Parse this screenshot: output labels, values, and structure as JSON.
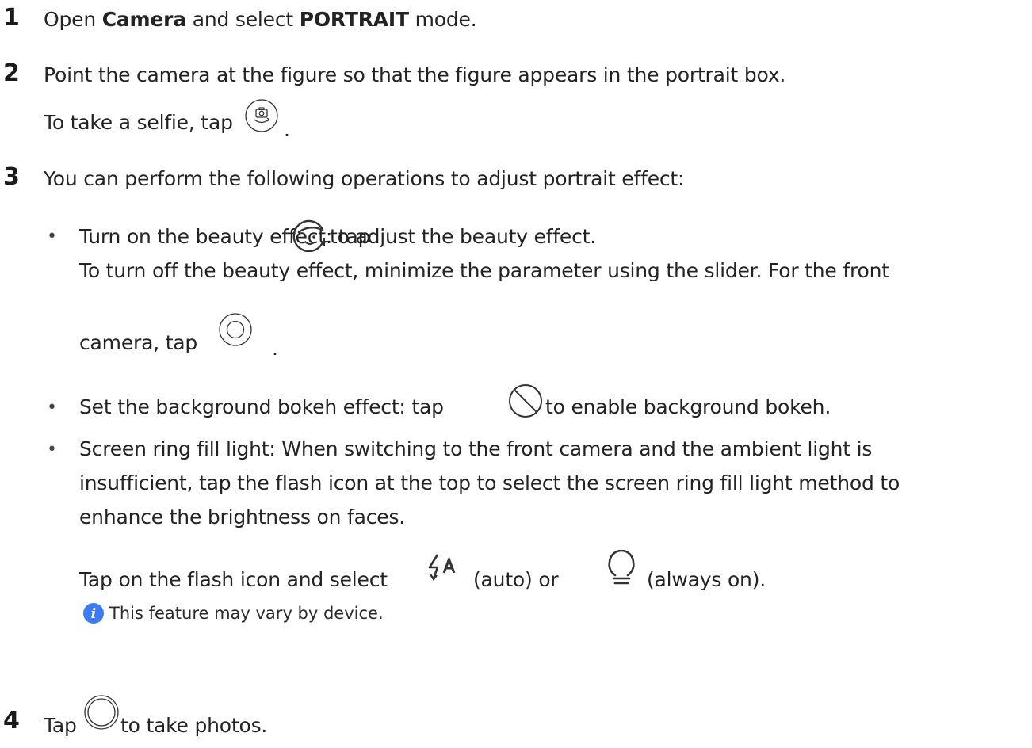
{
  "steps": [
    {
      "number": "1",
      "parts": [
        "Open ",
        "Camera",
        " and select ",
        "PORTRAIT",
        " mode."
      ]
    },
    {
      "number": "2",
      "text": "Point the camera at the figure so that the figure appears in the portrait box.",
      "sub": {
        "before": "To take a selfie, tap ",
        "after": "."
      }
    },
    {
      "number": "3",
      "text": "You can perform the following operations to adjust portrait effect:",
      "bullets": [
        {
          "before": "Turn on the beauty effect: tap ",
          "after": " to adjust the beauty effect.",
          "line2": "To turn off the beauty effect, minimize the parameter using the slider. For the front",
          "line3_before": "camera, tap ",
          "line3_after": "."
        },
        {
          "before": "Set the background bokeh effect: tap ",
          "after": " to enable background bokeh."
        },
        {
          "lines": [
            "Screen ring fill light: When switching to the front camera and the ambient light is",
            "insufficient, tap the flash icon at the top to select the screen ring fill light method to",
            "enhance the brightness on faces."
          ]
        }
      ],
      "flash_line": {
        "before": "Tap on the flash icon and select ",
        "mid": " (auto) or ",
        "after": " (always on)."
      },
      "note": "This feature may vary by device."
    },
    {
      "number": "4",
      "before": "Tap ",
      "after": " to take photos."
    }
  ],
  "colors": {
    "text": "#232323",
    "note_icon": "#3b7cf6"
  },
  "icons": [
    "switch-camera-icon",
    "beauty-face-icon",
    "front-beauty-ring-icon",
    "bokeh-off-icon",
    "flash-auto-icon",
    "bulb-always-on-icon",
    "info-icon",
    "shutter-icon"
  ]
}
